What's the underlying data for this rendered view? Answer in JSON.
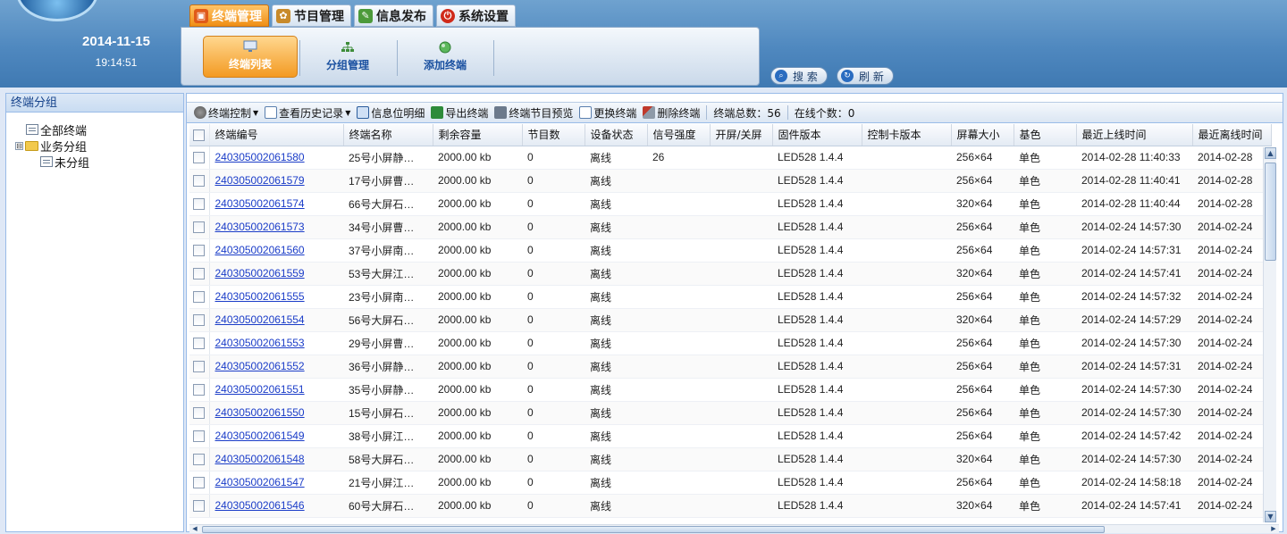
{
  "header": {
    "date": "2014-11-15",
    "time": "19:14:51",
    "tabs": [
      {
        "label": "终端管理",
        "icon": "terminal-icon",
        "active": true
      },
      {
        "label": "节目管理",
        "icon": "program-icon",
        "active": false
      },
      {
        "label": "信息发布",
        "icon": "publish-icon",
        "active": false
      },
      {
        "label": "系统设置",
        "icon": "power-icon",
        "active": false
      }
    ],
    "subnav": [
      {
        "label": "终端列表",
        "icon": "monitor-icon",
        "active": true
      },
      {
        "label": "分组管理",
        "icon": "group-tree-icon",
        "active": false
      },
      {
        "label": "添加终端",
        "icon": "add-globe-icon",
        "active": false
      }
    ],
    "search_label": "搜 索",
    "refresh_label": "刷 新",
    "accent": "#f39a22"
  },
  "sidebar": {
    "title": "终端分组",
    "tree": [
      {
        "label": "全部终端",
        "icon": "list-icon",
        "level": 0
      },
      {
        "label": "业务分组",
        "icon": "folder-icon",
        "level": 0,
        "expander": "⊟"
      },
      {
        "label": "未分组",
        "icon": "list-icon",
        "level": 1
      }
    ]
  },
  "toolbar": {
    "control": "终端控制",
    "history": "查看历史记录",
    "info_detail": "信息位明细",
    "export": "导出终端",
    "preview": "终端节目预览",
    "replace": "更换终端",
    "delete": "删除终端",
    "total": "终端总数：56",
    "online": "在线个数：0"
  },
  "table": {
    "columns": [
      "终端编号",
      "终端名称",
      "剩余容量",
      "节目数",
      "设备状态",
      "信号强度",
      "开屏/关屏",
      "固件版本",
      "控制卡版本",
      "屏幕大小",
      "基色",
      "最近上线时间",
      "最近离线时间"
    ],
    "rows": [
      [
        "240305002061580",
        "25号小屏静…",
        "2000.00 kb",
        "0",
        "离线",
        "26",
        "",
        "LED528 1.4.4",
        "",
        "256×64",
        "单色",
        "2014-02-28 11:40:33",
        "2014-02-28"
      ],
      [
        "240305002061579",
        "17号小屏曹…",
        "2000.00 kb",
        "0",
        "离线",
        "",
        "",
        "LED528 1.4.4",
        "",
        "256×64",
        "单色",
        "2014-02-28 11:40:41",
        "2014-02-28"
      ],
      [
        "240305002061574",
        "66号大屏石…",
        "2000.00 kb",
        "0",
        "离线",
        "",
        "",
        "LED528 1.4.4",
        "",
        "320×64",
        "单色",
        "2014-02-28 11:40:44",
        "2014-02-28"
      ],
      [
        "240305002061573",
        "34号小屏曹…",
        "2000.00 kb",
        "0",
        "离线",
        "",
        "",
        "LED528 1.4.4",
        "",
        "256×64",
        "单色",
        "2014-02-24 14:57:30",
        "2014-02-24"
      ],
      [
        "240305002061560",
        "37号小屏南…",
        "2000.00 kb",
        "0",
        "离线",
        "",
        "",
        "LED528 1.4.4",
        "",
        "256×64",
        "单色",
        "2014-02-24 14:57:31",
        "2014-02-24"
      ],
      [
        "240305002061559",
        "53号大屏江…",
        "2000.00 kb",
        "0",
        "离线",
        "",
        "",
        "LED528 1.4.4",
        "",
        "320×64",
        "单色",
        "2014-02-24 14:57:41",
        "2014-02-24"
      ],
      [
        "240305002061555",
        "23号小屏南…",
        "2000.00 kb",
        "0",
        "离线",
        "",
        "",
        "LED528 1.4.4",
        "",
        "256×64",
        "单色",
        "2014-02-24 14:57:32",
        "2014-02-24"
      ],
      [
        "240305002061554",
        "56号大屏石…",
        "2000.00 kb",
        "0",
        "离线",
        "",
        "",
        "LED528 1.4.4",
        "",
        "320×64",
        "单色",
        "2014-02-24 14:57:29",
        "2014-02-24"
      ],
      [
        "240305002061553",
        "29号小屏曹…",
        "2000.00 kb",
        "0",
        "离线",
        "",
        "",
        "LED528 1.4.4",
        "",
        "256×64",
        "单色",
        "2014-02-24 14:57:30",
        "2014-02-24"
      ],
      [
        "240305002061552",
        "36号小屏静…",
        "2000.00 kb",
        "0",
        "离线",
        "",
        "",
        "LED528 1.4.4",
        "",
        "256×64",
        "单色",
        "2014-02-24 14:57:31",
        "2014-02-24"
      ],
      [
        "240305002061551",
        "35号小屏静…",
        "2000.00 kb",
        "0",
        "离线",
        "",
        "",
        "LED528 1.4.4",
        "",
        "256×64",
        "单色",
        "2014-02-24 14:57:30",
        "2014-02-24"
      ],
      [
        "240305002061550",
        "15号小屏石…",
        "2000.00 kb",
        "0",
        "离线",
        "",
        "",
        "LED528 1.4.4",
        "",
        "256×64",
        "单色",
        "2014-02-24 14:57:30",
        "2014-02-24"
      ],
      [
        "240305002061549",
        "38号小屏江…",
        "2000.00 kb",
        "0",
        "离线",
        "",
        "",
        "LED528 1.4.4",
        "",
        "256×64",
        "单色",
        "2014-02-24 14:57:42",
        "2014-02-24"
      ],
      [
        "240305002061548",
        "58号大屏石…",
        "2000.00 kb",
        "0",
        "离线",
        "",
        "",
        "LED528 1.4.4",
        "",
        "320×64",
        "单色",
        "2014-02-24 14:57:30",
        "2014-02-24"
      ],
      [
        "240305002061547",
        "21号小屏江…",
        "2000.00 kb",
        "0",
        "离线",
        "",
        "",
        "LED528 1.4.4",
        "",
        "256×64",
        "单色",
        "2014-02-24 14:58:18",
        "2014-02-24"
      ],
      [
        "240305002061546",
        "60号大屏石…",
        "2000.00 kb",
        "0",
        "离线",
        "",
        "",
        "LED528 1.4.4",
        "",
        "320×64",
        "单色",
        "2014-02-24 14:57:41",
        "2014-02-24"
      ]
    ]
  }
}
